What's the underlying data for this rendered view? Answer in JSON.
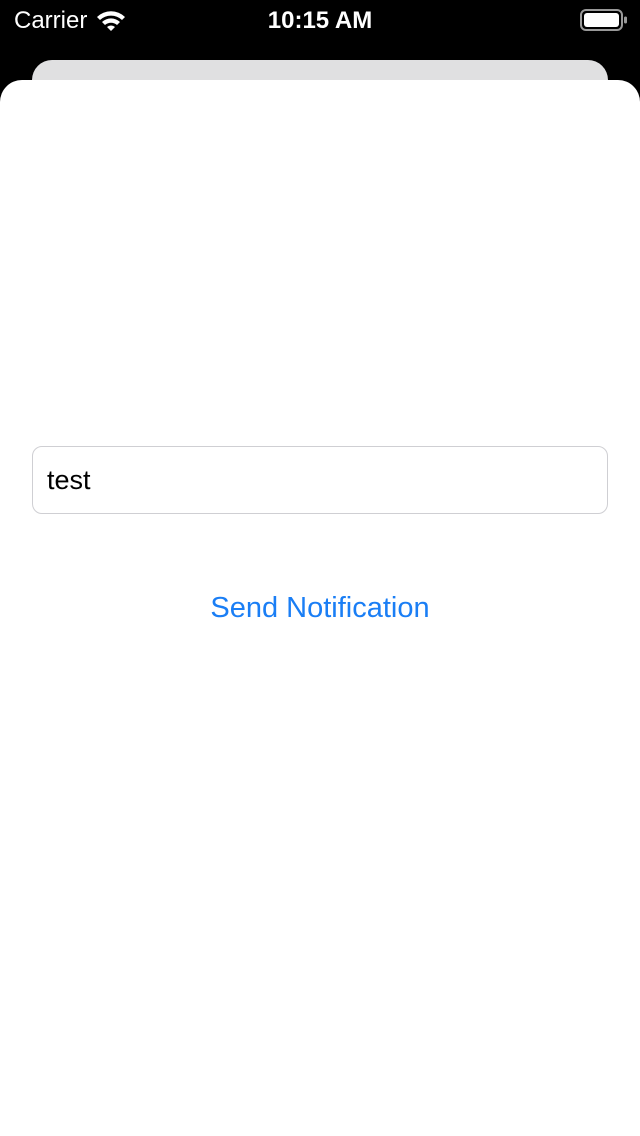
{
  "status_bar": {
    "carrier": "Carrier",
    "time": "10:15 AM",
    "wifi_icon": "wifi-icon",
    "battery_icon": "battery-icon"
  },
  "form": {
    "text_field_value": "test",
    "send_button_label": "Send Notification"
  },
  "colors": {
    "accent": "#1a7ef5",
    "status_bar_background": "#000000",
    "sheet_background": "#ffffff",
    "back_sheet_background": "#e0e0e1"
  }
}
